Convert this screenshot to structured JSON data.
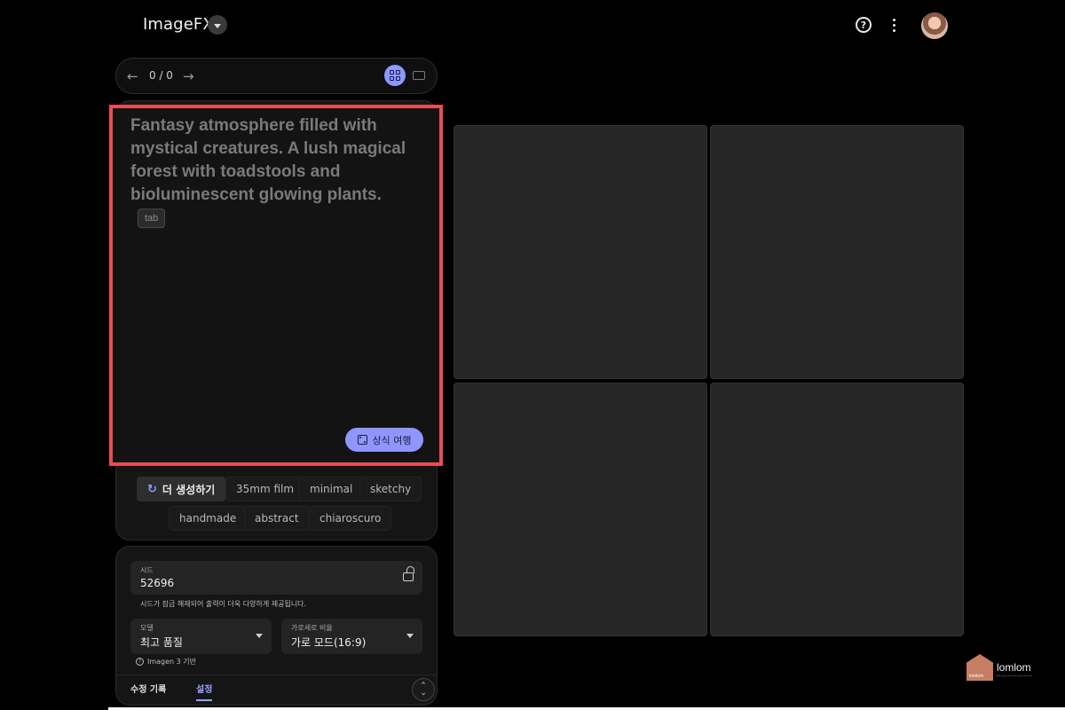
{
  "header": {
    "app_title": "ImageFX",
    "help_icon": "help-circle-icon",
    "more_icon": "more-vert-icon",
    "avatar": "user-avatar"
  },
  "nav": {
    "prev_glyph": "←",
    "next_glyph": "→",
    "count": "0 / 0",
    "active_view": "grid"
  },
  "prompt": {
    "text": "Fantasy atmosphere filled with mystical creatures. A lush magical forest with toadstools and bioluminescent glowing plants.",
    "tab_hint": "tab",
    "surprise_label": "상식 여행"
  },
  "chips": {
    "regenerate_label": "더 생성하기",
    "regenerate_icon": "↻",
    "items": [
      "35mm film",
      "minimal",
      "sketchy",
      "handmade",
      "abstract",
      "chiaroscuro"
    ]
  },
  "settings": {
    "seed_label": "시드",
    "seed_value": "52696",
    "seed_hint": "시드가 잠금 해제되어 출력이 더욱 다양하게 제공됩니다.",
    "model_label": "모델",
    "model_value": "최고 품질",
    "ratio_label": "가로세로 비율",
    "ratio_value": "가로 모드(16:9)",
    "model_note": "Imagen 3 기반",
    "info_glyph": "?"
  },
  "bottom_tabs": {
    "history": "수정 기록",
    "settings": "설정",
    "active": "settings"
  },
  "watermark": {
    "brand": "lomlom",
    "mark_text": "lomlom"
  },
  "colors": {
    "accent": "#8e97ff",
    "highlight_border": "#e84d55",
    "background": "#000000"
  }
}
